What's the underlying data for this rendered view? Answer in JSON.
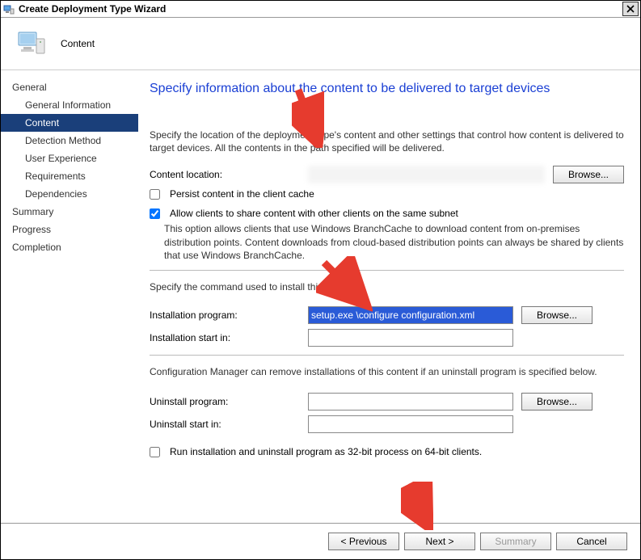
{
  "window": {
    "title": "Create Deployment Type Wizard"
  },
  "header": {
    "label": "Content"
  },
  "sidebar": {
    "group": "General",
    "general_information": "General Information",
    "content": "Content",
    "detection_method": "Detection Method",
    "user_experience": "User Experience",
    "requirements": "Requirements",
    "dependencies": "Dependencies",
    "summary": "Summary",
    "progress": "Progress",
    "completion": "Completion"
  },
  "page": {
    "heading": "Specify information about the content to be delivered to target devices",
    "intro": "Specify the location of the deployment type's content and other settings that control how content is delivered to target devices. All the contents in the path specified will be delivered.",
    "content_location_label": "Content location:",
    "browse": "Browse...",
    "persist_label": "Persist content in the client cache",
    "allow_share_label": "Allow clients to share content with other clients on the same subnet",
    "branchcache_note": "This option allows clients that use Windows BranchCache to download content from on-premises distribution points. Content downloads from cloud-based distribution points can always be shared by clients that use Windows BranchCache.",
    "specify_cmd": "Specify the command used to install this content.",
    "install_program_label": "Installation program:",
    "install_program_value": "setup.exe \\configure configuration.xml",
    "install_start_label": "Installation start in:",
    "install_start_value": "",
    "uninstall_note": "Configuration Manager can remove installations of this content if an uninstall program is specified below.",
    "uninstall_program_label": "Uninstall program:",
    "uninstall_program_value": "",
    "uninstall_start_label": "Uninstall start in:",
    "uninstall_start_value": "",
    "run32_label": "Run installation and uninstall program as 32-bit process on 64-bit clients."
  },
  "footer": {
    "previous": "< Previous",
    "next": "Next >",
    "summary": "Summary",
    "cancel": "Cancel"
  },
  "checkboxes": {
    "persist": false,
    "allow_share": true,
    "run32": false
  }
}
